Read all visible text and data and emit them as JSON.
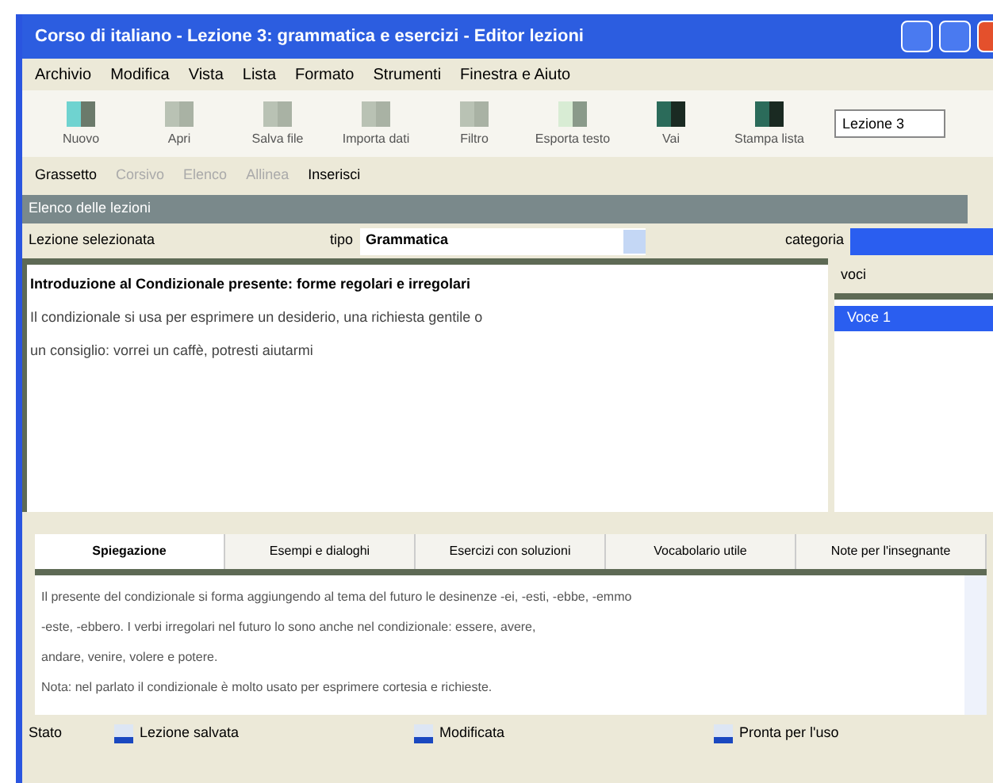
{
  "window": {
    "title": "Corso di italiano - Lezione 3: grammatica e esercizi - Editor lezioni"
  },
  "menu": [
    "Archivio",
    "Modifica",
    "Vista",
    "Lista",
    "Formato",
    "Strumenti",
    "Finestra e Aiuto"
  ],
  "toolbar": [
    {
      "label": "Nuovo",
      "kind": "teal"
    },
    {
      "label": "Apri",
      "kind": "grey"
    },
    {
      "label": "Salva file",
      "kind": "grey"
    },
    {
      "label": "Importa dati",
      "kind": "grey"
    },
    {
      "label": "Filtro",
      "kind": "grey"
    },
    {
      "label": "Esporta testo",
      "kind": "green"
    },
    {
      "label": "Vai",
      "kind": "dark"
    },
    {
      "label": "Stampa lista",
      "kind": "dark"
    }
  ],
  "toolbar_field": {
    "value": "Lezione 3"
  },
  "format_bar": [
    {
      "label": "Grassetto",
      "enabled": true
    },
    {
      "label": "Corsivo",
      "enabled": false
    },
    {
      "label": "Elenco",
      "enabled": false
    },
    {
      "label": "Allinea",
      "enabled": false
    },
    {
      "label": "Inserisci",
      "enabled": true
    }
  ],
  "section": {
    "title": "Elenco delle lezioni"
  },
  "filter": {
    "label": "Lezione selezionata",
    "type_label": "tipo",
    "type_value": "Grammatica",
    "category_label": "categoria"
  },
  "editor": {
    "lines": [
      "Introduzione al Condizionale presente: forme regolari e irregolari",
      "Il condizionale si usa per esprimere un desiderio, una richiesta gentile o",
      "un consiglio: vorrei un caffè, potresti aiutarmi"
    ]
  },
  "side_panel": {
    "heading": "voci",
    "items": [
      {
        "label": "Voce 1",
        "selected": true
      }
    ]
  },
  "tabs": [
    {
      "label": "Spiegazione",
      "selected": true
    },
    {
      "label": "Esempi e dialoghi",
      "selected": false
    },
    {
      "label": "Esercizi con soluzioni",
      "selected": false
    },
    {
      "label": "Vocabolario utile",
      "selected": false
    },
    {
      "label": "Note per l'insegnante",
      "selected": false
    }
  ],
  "notes": {
    "paragraphs": [
      "Il presente del condizionale si forma aggiungendo al tema del futuro le desinenze -ei, -esti, -ebbe, -emmo",
      "-este, -ebbero. I verbi irregolari nel futuro lo sono anche nel condizionale: essere, avere,",
      "andare, venire, volere e potere.",
      " Nota: nel parlato il condizionale è molto usato per esprimere cortesia e richieste."
    ]
  },
  "status": {
    "label": "Stato",
    "items": [
      "Lezione salvata",
      "Modificata",
      "Pronta per l'uso"
    ]
  }
}
